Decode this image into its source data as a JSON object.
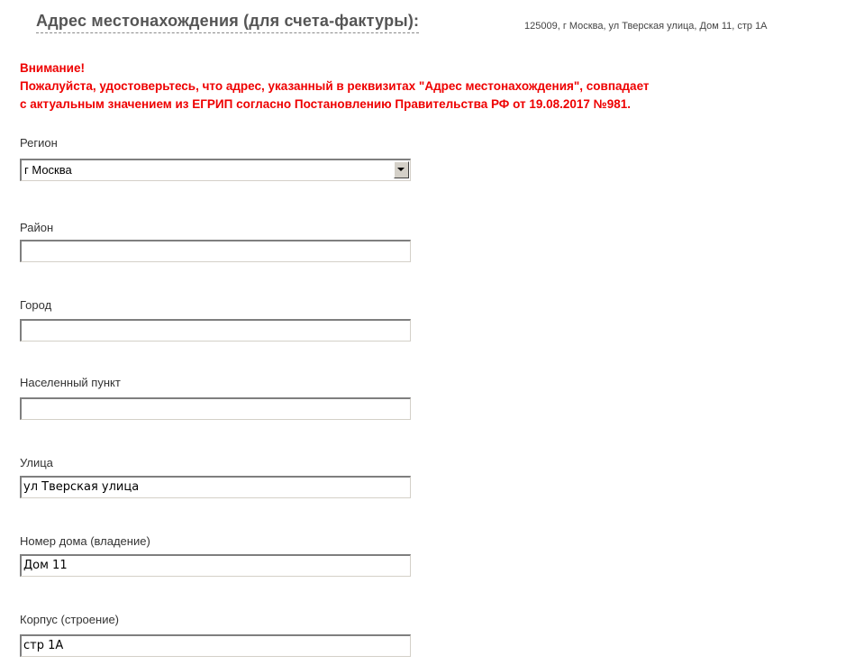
{
  "header": {
    "title": "Адрес местонахождения (для счета-фактуры)",
    "colon": ":",
    "address": "125009, г Москва, ул Тверская улица, Дом 11, стр 1А"
  },
  "warning": {
    "title": "Внимание!",
    "line1": "Пожалуйста, удостоверьтесь, что адрес, указанный в реквизитах \"Адрес местонахождения\", совпадает",
    "line2": "с актуальным значением из ЕГРИП согласно Постановлению Правительства РФ от 19.08.2017 №981."
  },
  "fields": {
    "region": {
      "label": "Регион",
      "value": "г Москва",
      "icon": "chevron-down-icon"
    },
    "district": {
      "label": "Район",
      "value": ""
    },
    "city": {
      "label": "Город",
      "value": ""
    },
    "locality": {
      "label": "Населенный пункт",
      "value": ""
    },
    "street": {
      "label": "Улица",
      "value": "ул Тверская улица"
    },
    "house": {
      "label": "Номер дома (владение)",
      "value": "Дом 11"
    },
    "building": {
      "label": "Корпус (строение)",
      "value": "стр 1А"
    }
  },
  "colors": {
    "warning": "#ee0000",
    "header_title": "#555555",
    "label": "#333333"
  }
}
